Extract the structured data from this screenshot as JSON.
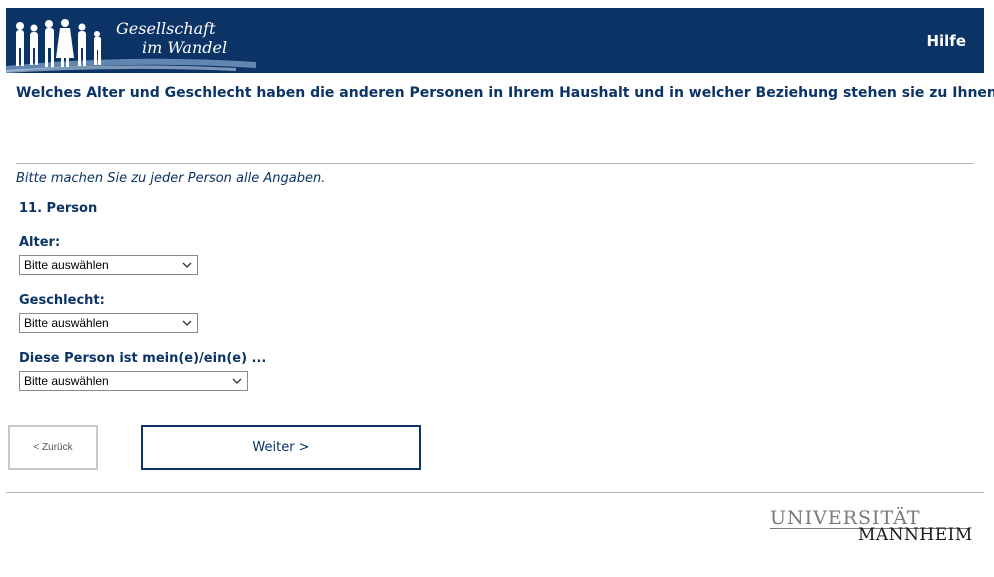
{
  "header": {
    "logo_line1": "Gesellschaft",
    "logo_line2": "im Wandel",
    "help_label": "Hilfe"
  },
  "question": "Welches Alter und Geschlecht haben die anderen Personen in Ihrem Haushalt und in welcher Beziehung stehen sie zu Ihnen?",
  "instruction": "Bitte machen Sie zu jeder Person alle Angaben.",
  "person_title": "11. Person",
  "fields": {
    "age": {
      "label": "Alter:",
      "value": "Bitte auswählen"
    },
    "gender": {
      "label": "Geschlecht:",
      "value": "Bitte auswählen"
    },
    "relation": {
      "label": "Diese Person ist mein(e)/ein(e) ...",
      "value": "Bitte auswählen"
    }
  },
  "nav": {
    "back_label": "< Zurück",
    "next_label": "Weiter >"
  },
  "footer": {
    "uni_line1": "UNIVERSITÄT",
    "uni_line2": "MANNHEIM"
  },
  "colors": {
    "brand": "#0b3366",
    "divider": "#b5b5b5"
  }
}
